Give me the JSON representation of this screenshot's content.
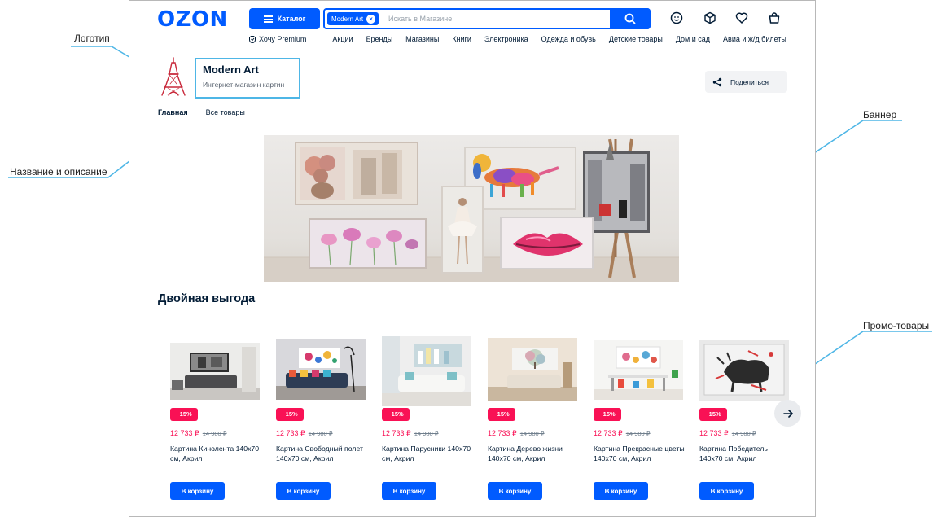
{
  "annotations": {
    "logo": "Логотип",
    "name_desc": "Название и описание",
    "banner": "Баннер",
    "promo": "Промо-товары"
  },
  "header": {
    "logo": "OZON",
    "catalog_label": "Каталог",
    "search_chip": "Modern Art",
    "search_placeholder": "Искать в Магазине",
    "nav": [
      "Хочу Premium",
      "Акции",
      "Бренды",
      "Магазины",
      "Книги",
      "Электроника",
      "Одежда и обувь",
      "Детские товары",
      "Дом и сад",
      "Авиа и ж/д билеты"
    ]
  },
  "store": {
    "name": "Modern Art",
    "description": "Интернет-магазин картин",
    "share_label": "Поделиться",
    "tabs": [
      "Главная",
      "Все товары"
    ]
  },
  "section_title": "Двойная выгода",
  "products": [
    {
      "badge": "−15%",
      "price": "12 733 ₽",
      "old_price": "14 980 ₽",
      "title": "Картина Кинолента 140х70 см, Акрил",
      "cart": "В корзину"
    },
    {
      "badge": "−15%",
      "price": "12 733 ₽",
      "old_price": "14 980 ₽",
      "title": "Картина Свободный полет 140х70 см, Акрил",
      "cart": "В корзину"
    },
    {
      "badge": "−15%",
      "price": "12 733 ₽",
      "old_price": "14 980 ₽",
      "title": "Картина Парусники 140х70 см, Акрил",
      "cart": "В корзину"
    },
    {
      "badge": "−15%",
      "price": "12 733 ₽",
      "old_price": "14 980 ₽",
      "title": "Картина Дерево жизни 140х70 см, Акрил",
      "cart": "В корзину"
    },
    {
      "badge": "−15%",
      "price": "12 733 ₽",
      "old_price": "14 980 ₽",
      "title": "Картина Прекрасные цветы 140х70 см, Акрил",
      "cart": "В корзину"
    },
    {
      "badge": "−15%",
      "price": "12 733 ₽",
      "old_price": "14 980 ₽",
      "title": "Картина Победитель 140х70 см, Акрил",
      "cart": "В корзину"
    }
  ],
  "colors": {
    "brand_blue": "#005bff",
    "discount_pink": "#f91155",
    "annotation_blue": "#4eb6e6"
  },
  "icons": [
    "catalog-menu-icon",
    "search-icon",
    "profile-icon",
    "orders-box-icon",
    "favorites-heart-icon",
    "cart-bag-icon",
    "share-icon",
    "arrow-right-icon",
    "premium-icon"
  ]
}
